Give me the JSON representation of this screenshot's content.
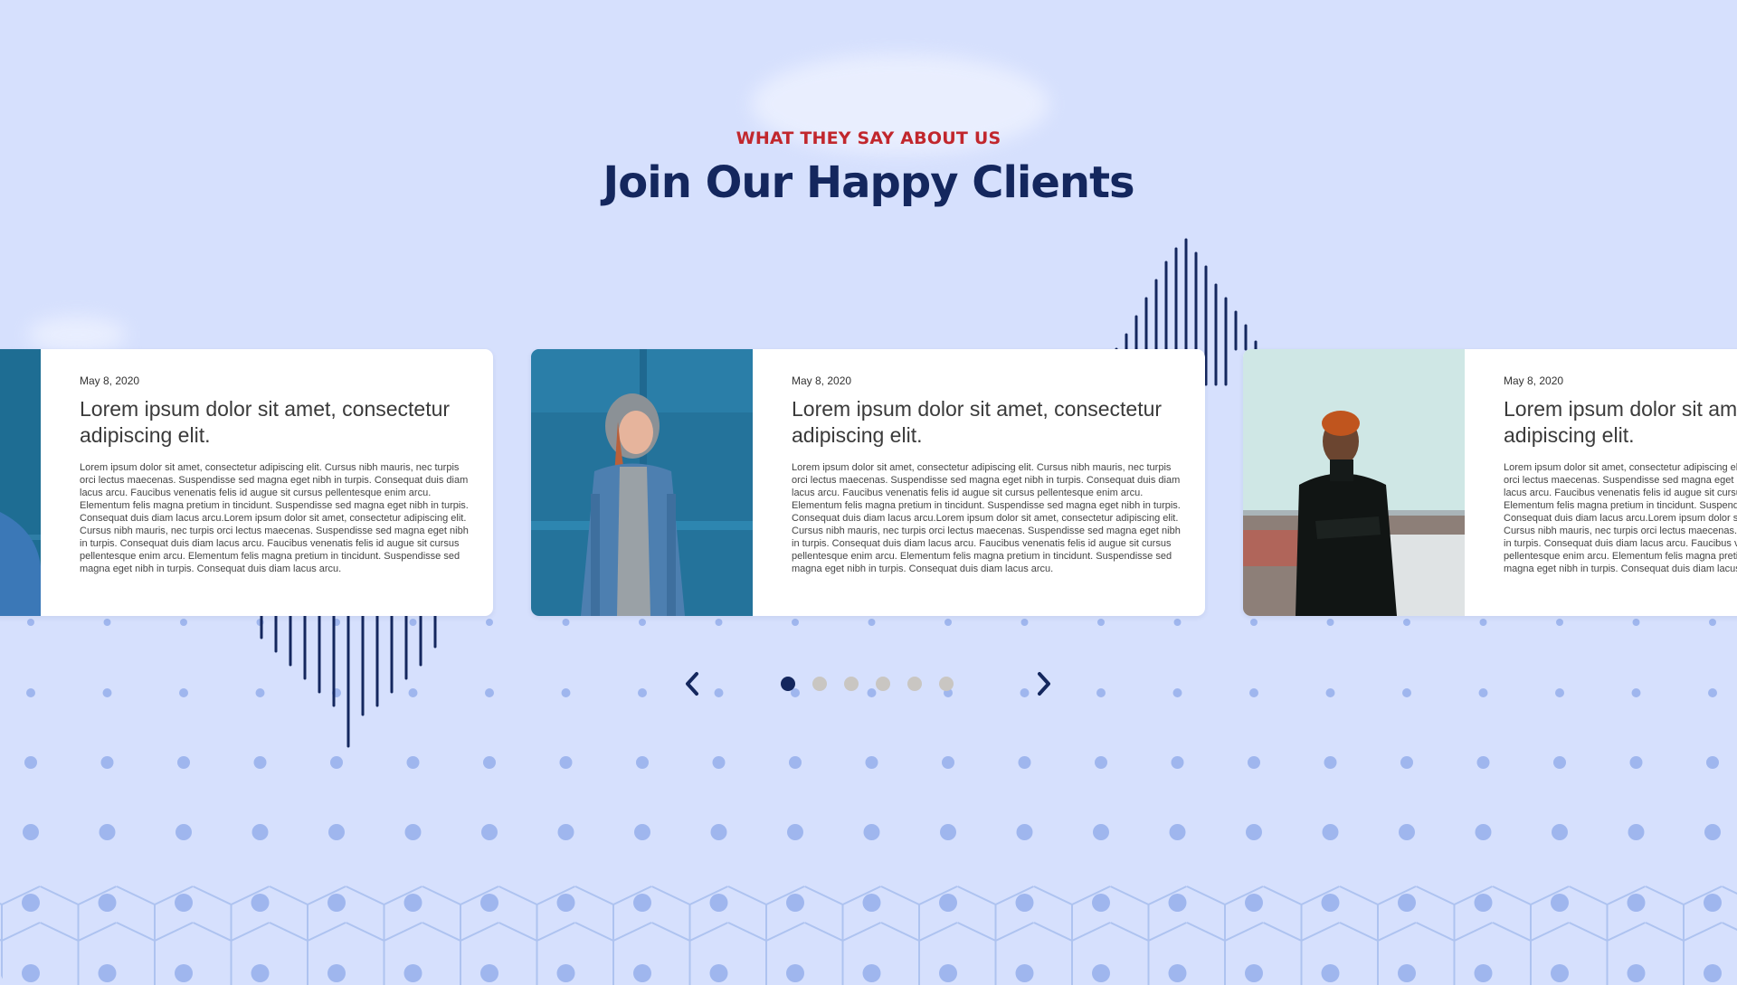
{
  "section": {
    "eyebrow": "WHAT THEY SAY ABOUT US",
    "title": "Join Our Happy Clients"
  },
  "testimonials": [
    {
      "date": "May 8, 2020",
      "title": "Lorem ipsum dolor sit amet, consectetur adipiscing elit.",
      "body": "Lorem ipsum dolor sit amet, consectetur adipiscing elit. Cursus nibh mauris, nec turpis orci lectus maecenas. Suspendisse sed magna eget nibh in turpis. Consequat duis diam lacus arcu. Faucibus venenatis felis id augue sit cursus pellentesque enim arcu. Elementum felis magna pretium in tincidunt. Suspendisse sed magna eget nibh in turpis. Consequat duis diam lacus arcu.Lorem ipsum dolor sit amet, consectetur adipiscing elit. Cursus nibh mauris, nec turpis orci lectus maecenas. Suspendisse sed magna eget nibh in turpis. Consequat duis diam lacus arcu. Faucibus venenatis felis id augue sit cursus pellentesque enim arcu. Elementum felis magna pretium in tincidunt. Suspendisse sed magna eget nibh in turpis. Consequat duis diam lacus arcu.",
      "photo": "person-photo-partial"
    },
    {
      "date": "May 8, 2020",
      "title": "Lorem ipsum dolor sit amet, consectetur adipiscing elit.",
      "body": "Lorem ipsum dolor sit amet, consectetur adipiscing elit. Cursus nibh mauris, nec turpis orci lectus maecenas. Suspendisse sed magna eget nibh in turpis. Consequat duis diam lacus arcu. Faucibus venenatis felis id augue sit cursus pellentesque enim arcu. Elementum felis magna pretium in tincidunt. Suspendisse sed magna eget nibh in turpis. Consequat duis diam lacus arcu.Lorem ipsum dolor sit amet, consectetur adipiscing elit. Cursus nibh mauris, nec turpis orci lectus maecenas. Suspendisse sed magna eget nibh in turpis. Consequat duis diam lacus arcu. Faucibus venenatis felis id augue sit cursus pellentesque enim arcu. Elementum felis magna pretium in tincidunt. Suspendisse sed magna eget nibh in turpis. Consequat duis diam lacus arcu.",
      "photo": "woman-hoodie-photo"
    },
    {
      "date": "May 8, 2020",
      "title": "Lorem ipsum dolor sit amet, consectetur adipiscing elit.",
      "body": "Lorem ipsum dolor sit amet, consectetur adipiscing elit. Cursus nibh mauris, nec turpis orci lectus maecenas. Suspendisse sed magna eget nibh in turpis. Consequat duis diam lacus arcu. Faucibus venenatis felis id augue sit cursus pellentesque enim arcu. Elementum felis magna pretium in tincidunt. Suspendisse sed magna eget nibh in turpis. Consequat duis diam lacus arcu.Lorem ipsum dolor sit amet, consectetur adipiscing elit. Cursus nibh mauris, nec turpis orci lectus maecenas. Suspendisse sed magna eget nibh in turpis. Consequat duis diam lacus arcu. Faucibus venenatis felis id augue sit cursus pellentesque enim arcu. Elementum felis magna pretium in tincidunt. Suspendisse sed magna eget nibh in turpis. Consequat duis diam lacus arcu.",
      "photo": "man-beanie-photo"
    }
  ],
  "carousel": {
    "prev_icon": "chevron-left-icon",
    "next_icon": "chevron-right-icon",
    "page_count": 6,
    "active_page": 1
  },
  "colors": {
    "background": "#d6e0fd",
    "accent_red": "#c1272d",
    "navy": "#14275e",
    "inactive_dot": "#c9c6c2",
    "pattern": "#aec3f0"
  }
}
